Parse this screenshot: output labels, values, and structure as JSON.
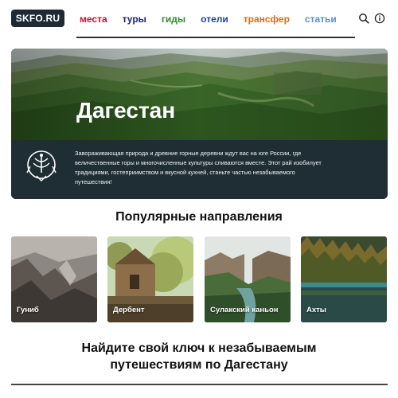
{
  "header": {
    "logo": "SKFO.RU",
    "nav": [
      {
        "label": "места",
        "color": "#c8102e"
      },
      {
        "label": "туры",
        "color": "#1a237e"
      },
      {
        "label": "гиды",
        "color": "#2e8b2e"
      },
      {
        "label": "отели",
        "color": "#1f3fa0"
      },
      {
        "label": "трансфер",
        "color": "#e06a10"
      },
      {
        "label": "статьи",
        "color": "#5b8fc0"
      }
    ],
    "icons": [
      "search-icon",
      "info-icon"
    ]
  },
  "hero": {
    "title": "Дагестан",
    "description": "Завораживающая природа и древние горные деревни ждут вас на юге России, где величественные горы и многочисленные культуры сливаются вместе. Этот рай изобилует традициями, гостеприимством и вкусной кухней, станьте частью незабываемого путешествия!"
  },
  "popular": {
    "title": "Популярные направления",
    "cards": [
      {
        "label": "Гуниб"
      },
      {
        "label": "Дербент"
      },
      {
        "label": "Сулакский каньон"
      },
      {
        "label": "Ахты"
      }
    ]
  },
  "bottom": {
    "line1": "Найдите свой ключ к незабываемым",
    "line2": "путешествиям по Дагестану"
  }
}
